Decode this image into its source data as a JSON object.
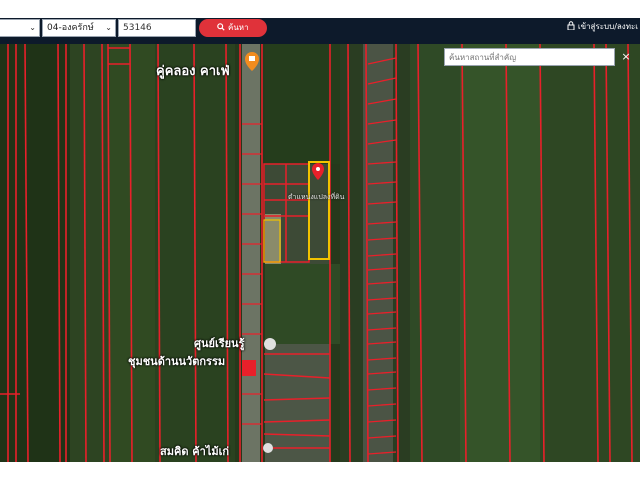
{
  "toolbar": {
    "district_value": "04-องครักษ์",
    "parcel_code_value": "53146",
    "search_label": "ค้นหา",
    "login_label": "เข้าสู่ระบบ/ลงทะเ"
  },
  "map_panel": {
    "place_search_placeholder": "ค้นหาสถานที่สำคัญ",
    "close_symbol": "×"
  },
  "map_labels": {
    "cafe": "คู่คลอง คาเฟ่",
    "parcel_position": "ตำแหน่งแปลงที่ดิน",
    "center_line1": "ศูนย์เรียนรู้",
    "center_line2": "ชุมชนด้านนวัตกรรม",
    "shop": "สมคิด ค้าไม้เก่"
  },
  "colors": {
    "navbar": "#0d1a2b",
    "search_button": "#e0323a",
    "parcel_line": "#e8202a",
    "selected_parcel": "#f2c200",
    "marker": "#e8202a",
    "poi_orange": "#f28c1f"
  },
  "icons": {
    "search": "magnifier-icon",
    "login": "lock-icon",
    "marker": "map-pin-icon",
    "poi": "cafe-poi-icon"
  }
}
